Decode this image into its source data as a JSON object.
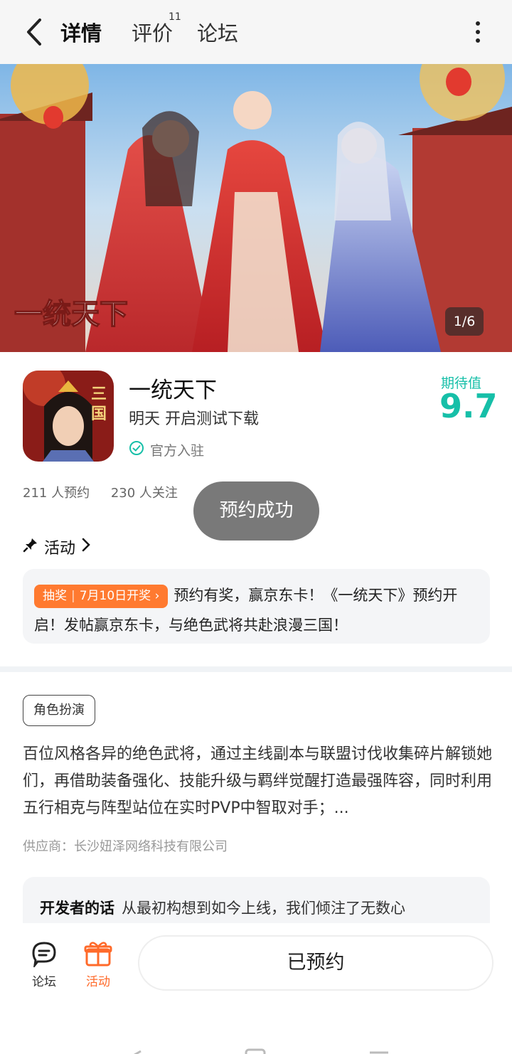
{
  "header": {
    "tabs": [
      {
        "label": "详情",
        "active": true
      },
      {
        "label": "评价",
        "badge": "11"
      },
      {
        "label": "论坛"
      }
    ]
  },
  "banner": {
    "logo_text": "一统天下",
    "counter": "1/6"
  },
  "app": {
    "icon_text": "三国",
    "name": "一统天下",
    "subtitle": "明天 开启测试下载",
    "official": "官方入驻",
    "expectation_label": "期待值",
    "expectation_value": "9.7",
    "reservations": "211 人预约",
    "follows": "230 人关注"
  },
  "toast": "预约成功",
  "activity": {
    "heading": "活动",
    "badge_type": "抽奖",
    "badge_date": "7月10日开奖",
    "text": "预约有奖，赢京东卡！《一统天下》预约开启！发帖赢京东卡，与绝色武将共赴浪漫三国！"
  },
  "about": {
    "tag": "角色扮演",
    "description": "百位风格各异的绝色武将，通过主线副本与联盟讨伐收集碎片解锁她们，再借助装备强化、技能升级与羁绊觉醒打造最强阵容，同时利用五行相克与阵型站位在实时PVP中智取对手；...",
    "supplier": "供应商：长沙妞泽网络科技有限公司",
    "dev_title": "开发者的话",
    "dev_text": "从最初构想到如今上线，我们倾注了无数心"
  },
  "bottom": {
    "forum_label": "论坛",
    "activity_label": "活动",
    "reserved_label": "已预约"
  },
  "colors": {
    "accent": "#1ec6b0",
    "orange": "#ff7a30"
  }
}
